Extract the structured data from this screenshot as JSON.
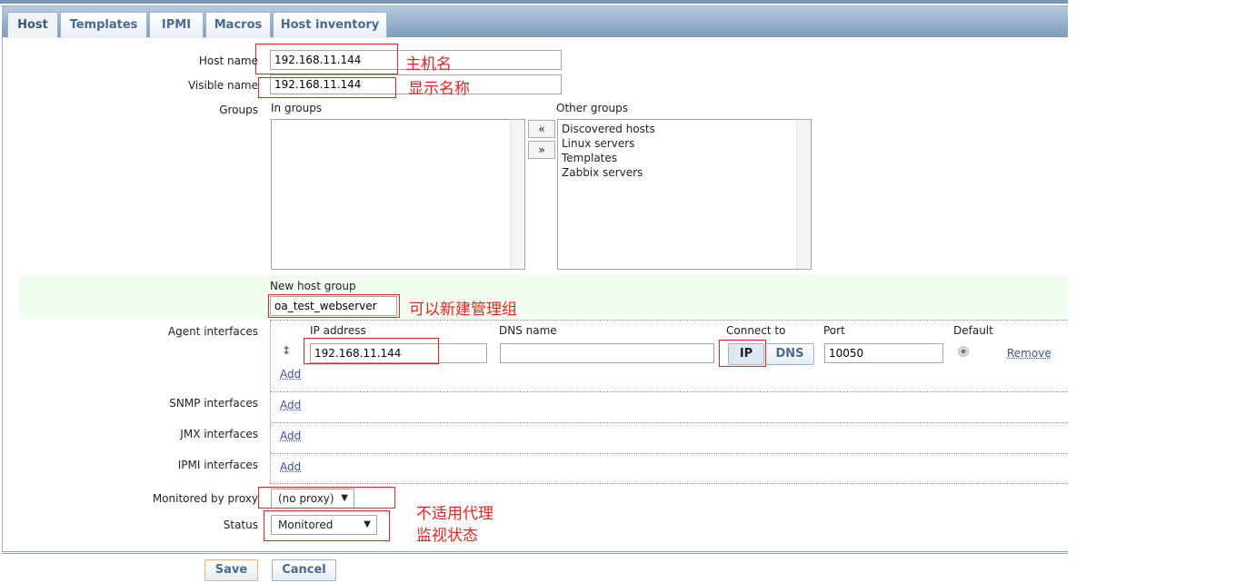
{
  "tabs": [
    {
      "label": "Host"
    },
    {
      "label": "Templates"
    },
    {
      "label": "IPMI"
    },
    {
      "label": "Macros"
    },
    {
      "label": "Host inventory"
    }
  ],
  "form": {
    "host_name": {
      "label": "Host name",
      "value": "192.168.11.144",
      "note": "主机名"
    },
    "visible_name": {
      "label": "Visible name",
      "value": "192.168.11.144",
      "note": "显示名称"
    },
    "groups": {
      "label": "Groups",
      "in_label": "In groups",
      "other_label": "Other groups",
      "in_groups": [],
      "other_groups": [
        "Discovered hosts",
        "Linux servers",
        "Templates",
        "Zabbix servers"
      ],
      "add_btn": "«",
      "remove_btn": "»"
    },
    "new_group": {
      "label": "New host group",
      "value": "oa_test_webserver",
      "note": "可以新建管理组"
    },
    "agent": {
      "label": "Agent interfaces",
      "col_ip": "IP address",
      "col_dns": "DNS name",
      "col_connect": "Connect to",
      "col_port": "Port",
      "col_default": "Default",
      "ip": "192.168.11.144",
      "dns": "",
      "connect_ip": "IP",
      "connect_dns": "DNS",
      "port": "10050",
      "remove": "Remove",
      "add": "Add"
    },
    "snmp": {
      "label": "SNMP interfaces",
      "add": "Add"
    },
    "jmx": {
      "label": "JMX interfaces",
      "add": "Add"
    },
    "ipmi": {
      "label": "IPMI interfaces",
      "add": "Add"
    },
    "proxy": {
      "label": "Monitored by proxy",
      "value": "(no proxy)",
      "note": "不适用代理"
    },
    "status": {
      "label": "Status",
      "value": "Monitored",
      "note": "监视状态"
    }
  },
  "buttons": {
    "save": "Save",
    "cancel": "Cancel"
  }
}
